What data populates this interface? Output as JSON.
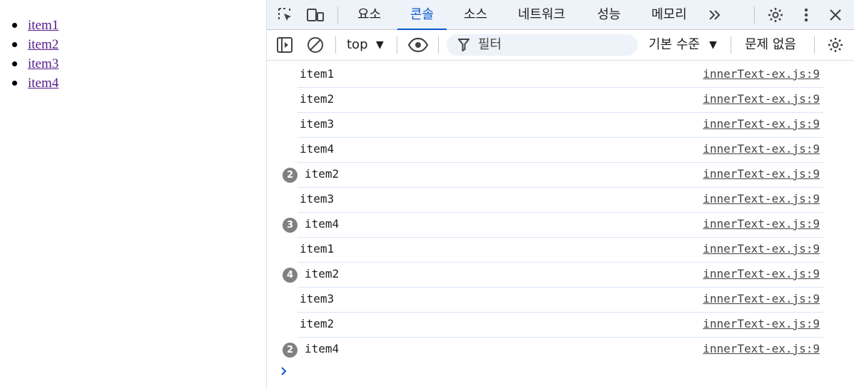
{
  "page": {
    "links": [
      "item1",
      "item2",
      "item3",
      "item4"
    ]
  },
  "devtools": {
    "tabs": [
      {
        "label": "요소",
        "active": false
      },
      {
        "label": "콘솔",
        "active": true
      },
      {
        "label": "소스",
        "active": false
      },
      {
        "label": "네트워크",
        "active": false
      },
      {
        "label": "성능",
        "active": false
      },
      {
        "label": "메모리",
        "active": false
      }
    ],
    "toolbar": {
      "context": "top",
      "filter_placeholder": "필터",
      "levels": "기본 수준",
      "issues": "문제 없음"
    },
    "console": {
      "source": "innerText-ex.js:9",
      "rows": [
        {
          "text": "item1",
          "count": ""
        },
        {
          "text": "item2",
          "count": ""
        },
        {
          "text": "item3",
          "count": ""
        },
        {
          "text": "item4",
          "count": ""
        },
        {
          "text": "item2",
          "count": "2"
        },
        {
          "text": "item3",
          "count": ""
        },
        {
          "text": "item4",
          "count": "3"
        },
        {
          "text": "item1",
          "count": ""
        },
        {
          "text": "item2",
          "count": "4"
        },
        {
          "text": "item3",
          "count": ""
        },
        {
          "text": "item2",
          "count": ""
        },
        {
          "text": "item4",
          "count": "2"
        }
      ]
    },
    "colors": {
      "accent": "#0b57d0",
      "link": "#551a8b",
      "badge": "#808080"
    }
  }
}
